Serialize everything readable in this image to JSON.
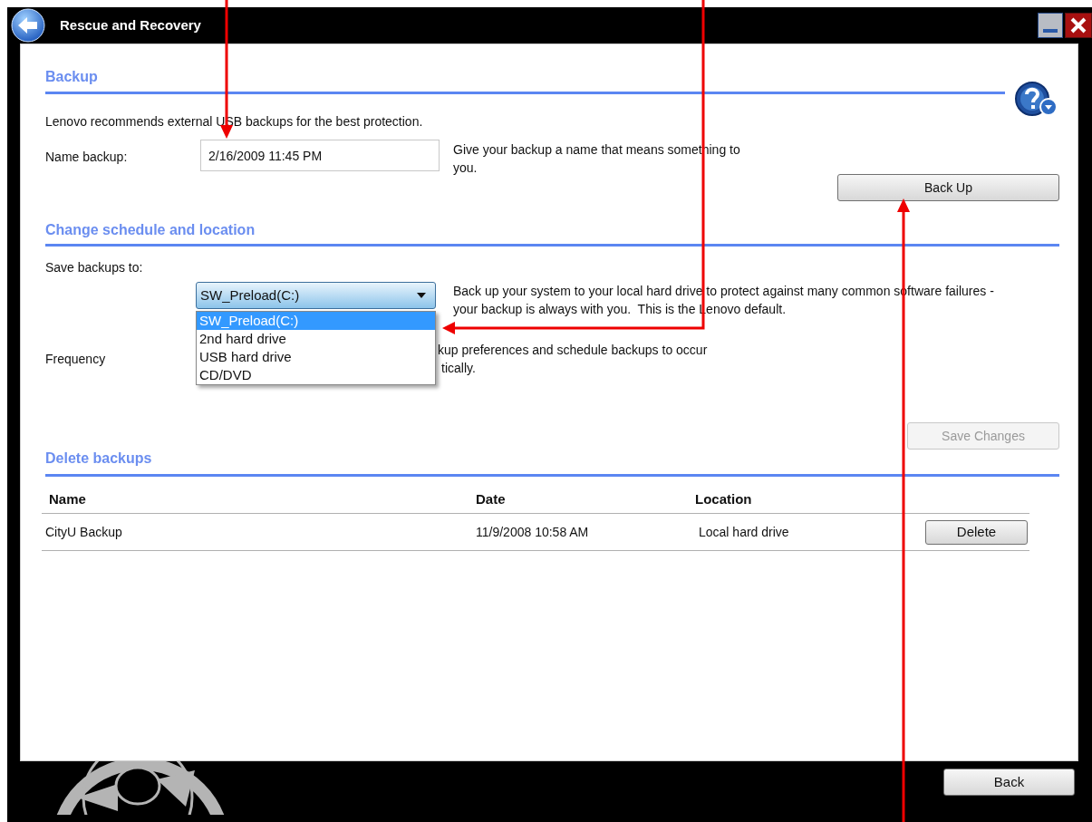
{
  "window": {
    "title": "Rescue and Recovery"
  },
  "backup": {
    "heading": "Backup",
    "note": "Lenovo recommends external USB backups for the best protection.",
    "name_label": "Name backup:",
    "name_value": "2/16/2009 11:45 PM",
    "name_hint": "Give your backup a name that means something to you.",
    "button": {
      "label": "Back Up",
      "disabled": false
    }
  },
  "schedule": {
    "heading": "Change schedule and location",
    "save_label": "Save backups to:",
    "location": {
      "value": "SW_Preload(C:)",
      "expanded": true,
      "options": [
        {
          "label": "SW_Preload(C:)",
          "selected": true
        },
        {
          "label": "2nd hard drive",
          "selected": false
        },
        {
          "label": "USB hard drive",
          "selected": false
        },
        {
          "label": "CD/DVD",
          "selected": false
        }
      ]
    },
    "location_hint": "Back up your system to your local hard drive to protect against many common software failures - your backup is always with you.  This is the Lenovo default.",
    "frequency_label": "Frequency",
    "frequency_hint": [
      "kup preferences and schedule backups to occur",
      "tically."
    ],
    "button": {
      "label": "Save Changes",
      "disabled": true
    }
  },
  "delete": {
    "heading": "Delete backups",
    "columns": [
      "Name",
      "Date",
      "Location"
    ],
    "rows": [
      {
        "name": "CityU Backup",
        "date": "11/9/2008 10:58 AM",
        "location": "Local hard drive",
        "button": "Delete"
      }
    ]
  },
  "footer": {
    "button": "Back"
  }
}
